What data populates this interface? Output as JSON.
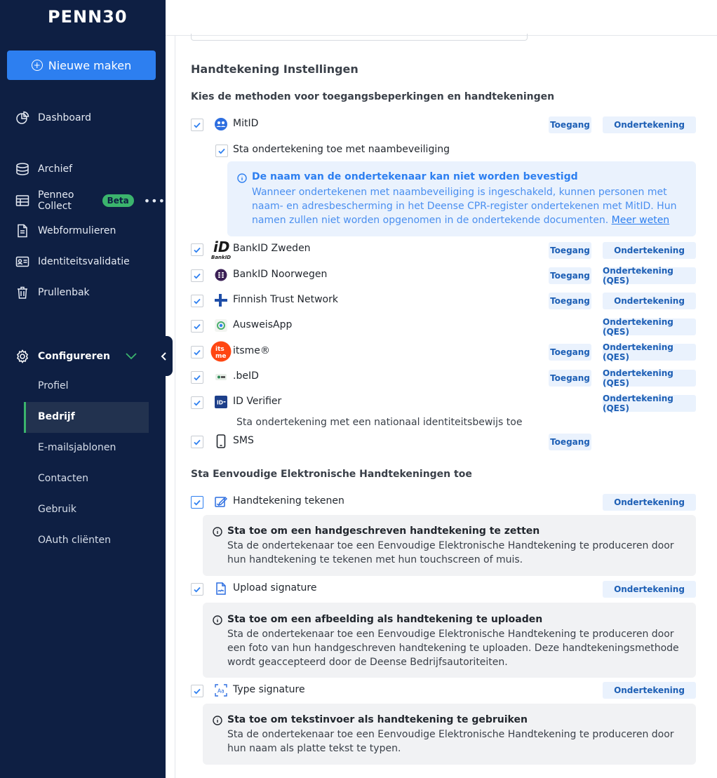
{
  "brand": {
    "logo_text": "PENN30"
  },
  "sidebar": {
    "new_button": "Nieuwe maken",
    "items": [
      {
        "label": "Dashboard",
        "icon": "pie-chart-icon"
      },
      {
        "label": "Archief",
        "icon": "archive-icon"
      },
      {
        "label": "Penneo Collect",
        "icon": "table-icon",
        "badge": "Beta"
      },
      {
        "label": "Webformulieren",
        "icon": "document-icon"
      },
      {
        "label": "Identiteitsvalidatie",
        "icon": "id-card-icon"
      },
      {
        "label": "Prullenbak",
        "icon": "trash-icon"
      }
    ],
    "config": {
      "label": "Configureren",
      "sub_items": [
        "Profiel",
        "Bedrijf",
        "E-mailsjablonen",
        "Contacten",
        "Gebruik",
        "OAuth cliënten"
      ],
      "active": "Bedrijf"
    }
  },
  "content": {
    "title": "Handtekening Instellingen",
    "methods_heading": "Kies de methoden voor toegangsbeperkingen en handtekeningen",
    "methods": [
      {
        "label": "MitID",
        "toegang": "Toegang",
        "onder": "Ondertekening"
      },
      {
        "label": "BankID Zweden",
        "toegang": "Toegang",
        "onder": "Ondertekening"
      },
      {
        "label": "BankID Noorwegen",
        "toegang": "Toegang",
        "onder": "Ondertekening (QES)"
      },
      {
        "label": "Finnish Trust Network",
        "toegang": "Toegang",
        "onder": "Ondertekening"
      },
      {
        "label": "AusweisApp",
        "onder": "Ondertekening (QES)"
      },
      {
        "label": "itsme®",
        "toegang": "Toegang",
        "onder": "Ondertekening (QES)"
      },
      {
        "label": ".beID",
        "toegang": "Toegang",
        "onder": "Ondertekening (QES)"
      },
      {
        "label": "ID Verifier",
        "onder": "Ondertekening (QES)"
      },
      {
        "label": "SMS",
        "toegang": "Toegang"
      }
    ],
    "mitid_sub": "Sta ondertekening toe met naambeveiliging",
    "mitid_info": {
      "title": "De naam van de ondertekenaar kan niet worden bevestigd",
      "text": "Wanneer ondertekenen met naambeveiliging is ingeschakeld, kunnen personen met naam- en adresbescherming in het Deense CPR-register ondertekenen met MitID. Hun namen zullen niet worden opgenomen in de ondertekende documenten.",
      "link": "Meer weten"
    },
    "id_verifier_sub": "Sta ondertekening met een nationaal identiteitsbewijs toe",
    "ses_heading": "Sta Eenvoudige Elektronische Handtekeningen toe",
    "ses": [
      {
        "label": "Handtekening tekenen",
        "onder": "Ondertekening",
        "info_title": "Sta toe om een handgeschreven handtekening te zetten",
        "info_text": "Sta de ondertekenaar toe een Eenvoudige Elektronische Handtekening te produceren door hun handtekening te tekenen met hun touchscreen of muis."
      },
      {
        "label": "Upload signature",
        "onder": "Ondertekening",
        "info_title": "Sta toe om een afbeelding als handtekening te uploaden",
        "info_text": "Sta de ondertekenaar toe een Eenvoudige Elektronische Handtekening te produceren door een foto van hun handgeschreven handtekening te uploaden. Deze handtekeningsmethode wordt geaccepteerd door de Deense Bedrijfsautoriteiten."
      },
      {
        "label": "Type signature",
        "onder": "Ondertekening",
        "info_title": "Sta toe om tekstinvoer als handtekening te gebruiken",
        "info_text": "Sta de ondertekenaar toe een Eenvoudige Elektronische Handtekening te produceren door hun naam als platte tekst te typen."
      }
    ]
  },
  "colors": {
    "sidebar_bg": "#0e1f43",
    "accent": "#2d7ff0",
    "active_green": "#3bb46d",
    "pill_bg": "#eaf2fd"
  }
}
